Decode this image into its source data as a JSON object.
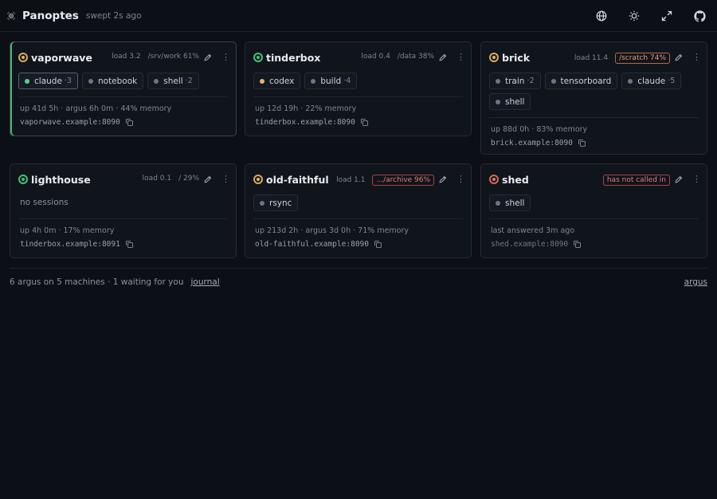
{
  "app": {
    "title": "Panoptes",
    "swept": "swept 2s ago"
  },
  "toolbar": {
    "icons": [
      "globe-icon",
      "sun-icon",
      "expand-icon",
      "github-icon"
    ]
  },
  "colors": {
    "background": "#0c0f15",
    "status_ok": "#49bf7b",
    "status_warn": "#d9a75f",
    "status_down": "#d2685f"
  },
  "cards": [
    {
      "name": "vaporwave",
      "status": "amber",
      "load": "load 3.2",
      "disk": "/srv/work 61%",
      "disk_style": "plain",
      "sessions": [
        {
          "label": "claude",
          "count": "·3",
          "dot": "green",
          "active": true
        },
        {
          "label": "notebook",
          "count": "",
          "dot": "grey"
        },
        {
          "label": "shell",
          "count": "·2",
          "dot": "grey"
        }
      ],
      "foot": "up 41d 5h · argus 6h 0m · 44% memory",
      "address": "vaporwave.example:8090"
    },
    {
      "name": "tinderbox",
      "status": "green",
      "load": "load 0.4",
      "disk": "/data 38%",
      "disk_style": "plain",
      "sessions": [
        {
          "label": "codex",
          "count": "",
          "dot": "amber"
        },
        {
          "label": "build",
          "count": "·4",
          "dot": "grey"
        }
      ],
      "foot": "up 12d 19h · 22% memory",
      "address": "tinderbox.example:8090"
    },
    {
      "name": "brick",
      "status": "amber",
      "load": "load 11.4",
      "disk": "/scratch 74%",
      "disk_style": "warn",
      "sessions": [
        {
          "label": "train",
          "count": "·2",
          "dot": "grey"
        },
        {
          "label": "tensorboard",
          "count": "",
          "dot": "grey"
        },
        {
          "label": "claude",
          "count": "·5",
          "dot": "grey"
        },
        {
          "label": "shell",
          "count": "",
          "dot": "grey"
        }
      ],
      "foot": "up 88d 0h · 83% memory",
      "address": "brick.example:8090"
    },
    {
      "name": "lighthouse",
      "status": "green",
      "load": "load 0.1",
      "disk": "/ 29%",
      "disk_style": "plain",
      "empty_text": "no sessions",
      "foot": "up 4h 0m · 17% memory",
      "address": "tinderbox.example:8091"
    },
    {
      "name": "old-faithful",
      "status": "amber",
      "load": "load 1.1",
      "disk": ".../archive 96%",
      "disk_style": "alert",
      "sessions": [
        {
          "label": "rsync",
          "count": "",
          "dot": "grey"
        }
      ],
      "foot": "up 213d 2h · argus 3d 0h · 71% memory",
      "address": "old-faithful.example:8090"
    },
    {
      "name": "shed",
      "status": "red",
      "load": "",
      "disk": "has not called in",
      "disk_style": "alert",
      "sessions": [
        {
          "label": "shell",
          "count": "",
          "dot": "grey"
        }
      ],
      "foot": "last answered 3m ago",
      "address": "shed.example:8090"
    }
  ],
  "footer": {
    "summary": "6 argus on 5 machines · 1 waiting for you",
    "journal": "journal",
    "argus": "argus"
  }
}
